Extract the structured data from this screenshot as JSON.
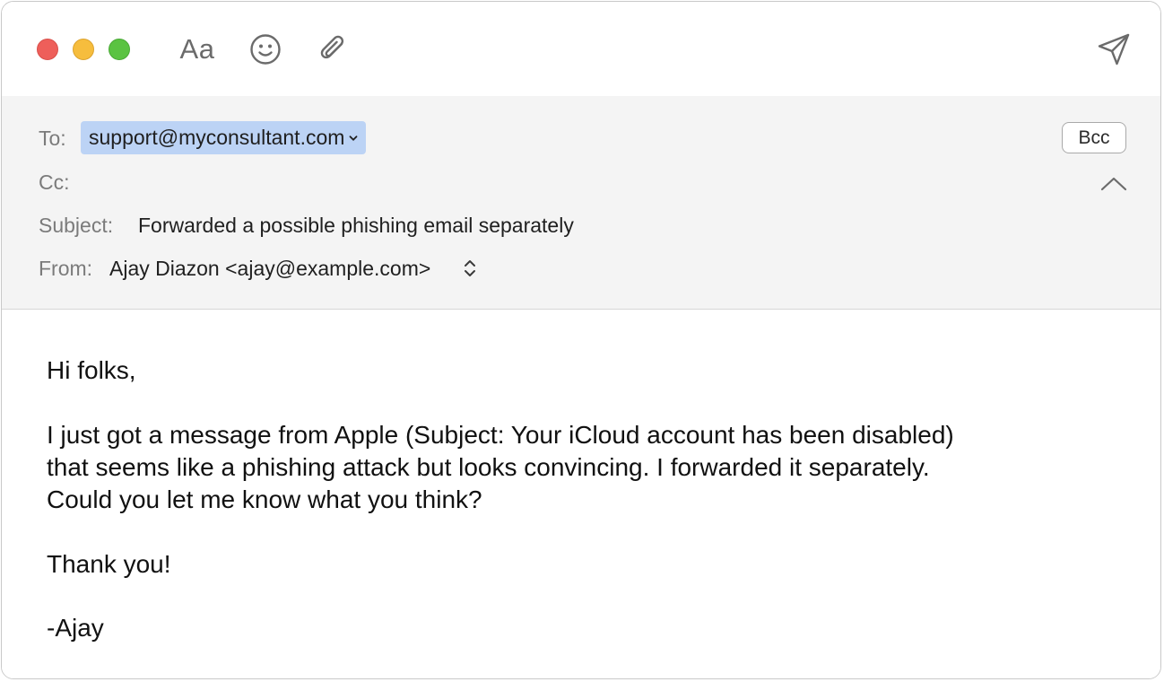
{
  "window": {
    "controls": [
      "close",
      "minimize",
      "zoom"
    ],
    "colors": {
      "close": "#ee5f5a",
      "minimize": "#f6bd3d",
      "zoom": "#5ac341",
      "token_bg": "#bcd3f5",
      "header_bg": "#f4f4f4"
    }
  },
  "toolbar": {
    "font_label": "Aa",
    "emoji_icon": "smiley-icon",
    "attach_icon": "paperclip-icon",
    "send_icon": "send-paper-plane-icon"
  },
  "header": {
    "to_label": "To:",
    "to_recipient": "support@myconsultant.com",
    "cc_label": "Cc:",
    "subject_label": "Subject:",
    "subject_value": "Forwarded a possible phishing email separately",
    "from_label": "From:",
    "from_value": "Ajay Diazon <ajay@example.com>",
    "bcc_label": "Bcc"
  },
  "message": {
    "greeting": "Hi folks,",
    "paragraph_lines": [
      "I just got a message from Apple (Subject: Your iCloud account has been disabled)",
      "that seems like a phishing attack but looks convincing. I forwarded it separately.",
      "Could you let me know what you think?"
    ],
    "closing": "Thank you!",
    "signature": "-Ajay"
  }
}
